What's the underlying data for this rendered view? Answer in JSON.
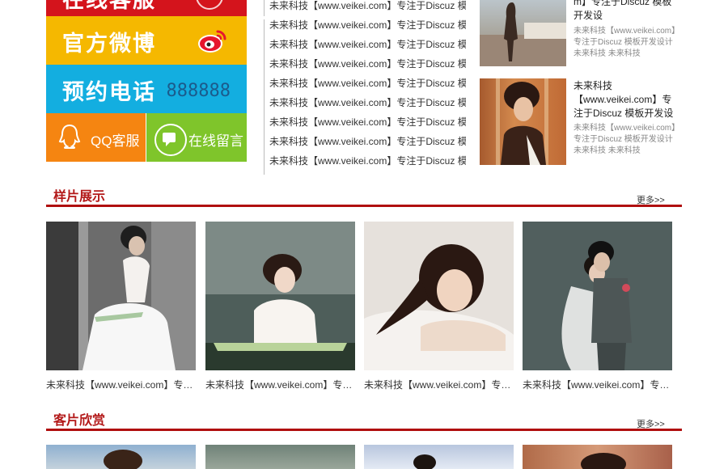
{
  "contact_tiles": {
    "top_label": "在线客服",
    "weibo_label": "官方微博",
    "phone_label": "预约电话",
    "phone_number": "888888",
    "qq_label": "QQ客服",
    "message_label": "在线留言",
    "colors": {
      "red": "#d4141c",
      "yellow": "#f5b800",
      "blue": "#13aee0",
      "orange": "#f58511",
      "green": "#7fc52b"
    }
  },
  "news_list": [
    "未来科技【www.veikei.com】专注于Discuz 模",
    "未来科技【www.veikei.com】专注于Discuz 模",
    "未来科技【www.veikei.com】专注于Discuz 模",
    "未来科技【www.veikei.com】专注于Discuz 模",
    "未来科技【www.veikei.com】专注于Discuz 模",
    "未来科技【www.veikei.com】专注于Discuz 模",
    "未来科技【www.veikei.com】专注于Discuz 模",
    "未来科技【www.veikei.com】专注于Discuz 模",
    "未来科技【www.veikei.com】专注于Discuz 模"
  ],
  "featured": [
    {
      "title": "m】专注于Discuz 模板开发设",
      "desc": "未来科技【www.veikei.com】专注于Discuz 模板开发设计 未来科技 未来科技"
    },
    {
      "title": "未来科技【www.veikei.com】专注于Discuz 模板开发设",
      "desc": "未来科技【www.veikei.com】专注于Discuz 模板开发设计 未来科技 未来科技"
    }
  ],
  "samples": {
    "title": "样片展示",
    "more": "更多>>",
    "items": [
      {
        "caption": "未来科技【www.veikei.com】专注..."
      },
      {
        "caption": "未来科技【www.veikei.com】专注..."
      },
      {
        "caption": "未来科技【www.veikei.com】专注..."
      },
      {
        "caption": "未来科技【www.veikei.com】专注..."
      }
    ]
  },
  "customer": {
    "title": "客片欣赏",
    "more": "更多>>"
  }
}
